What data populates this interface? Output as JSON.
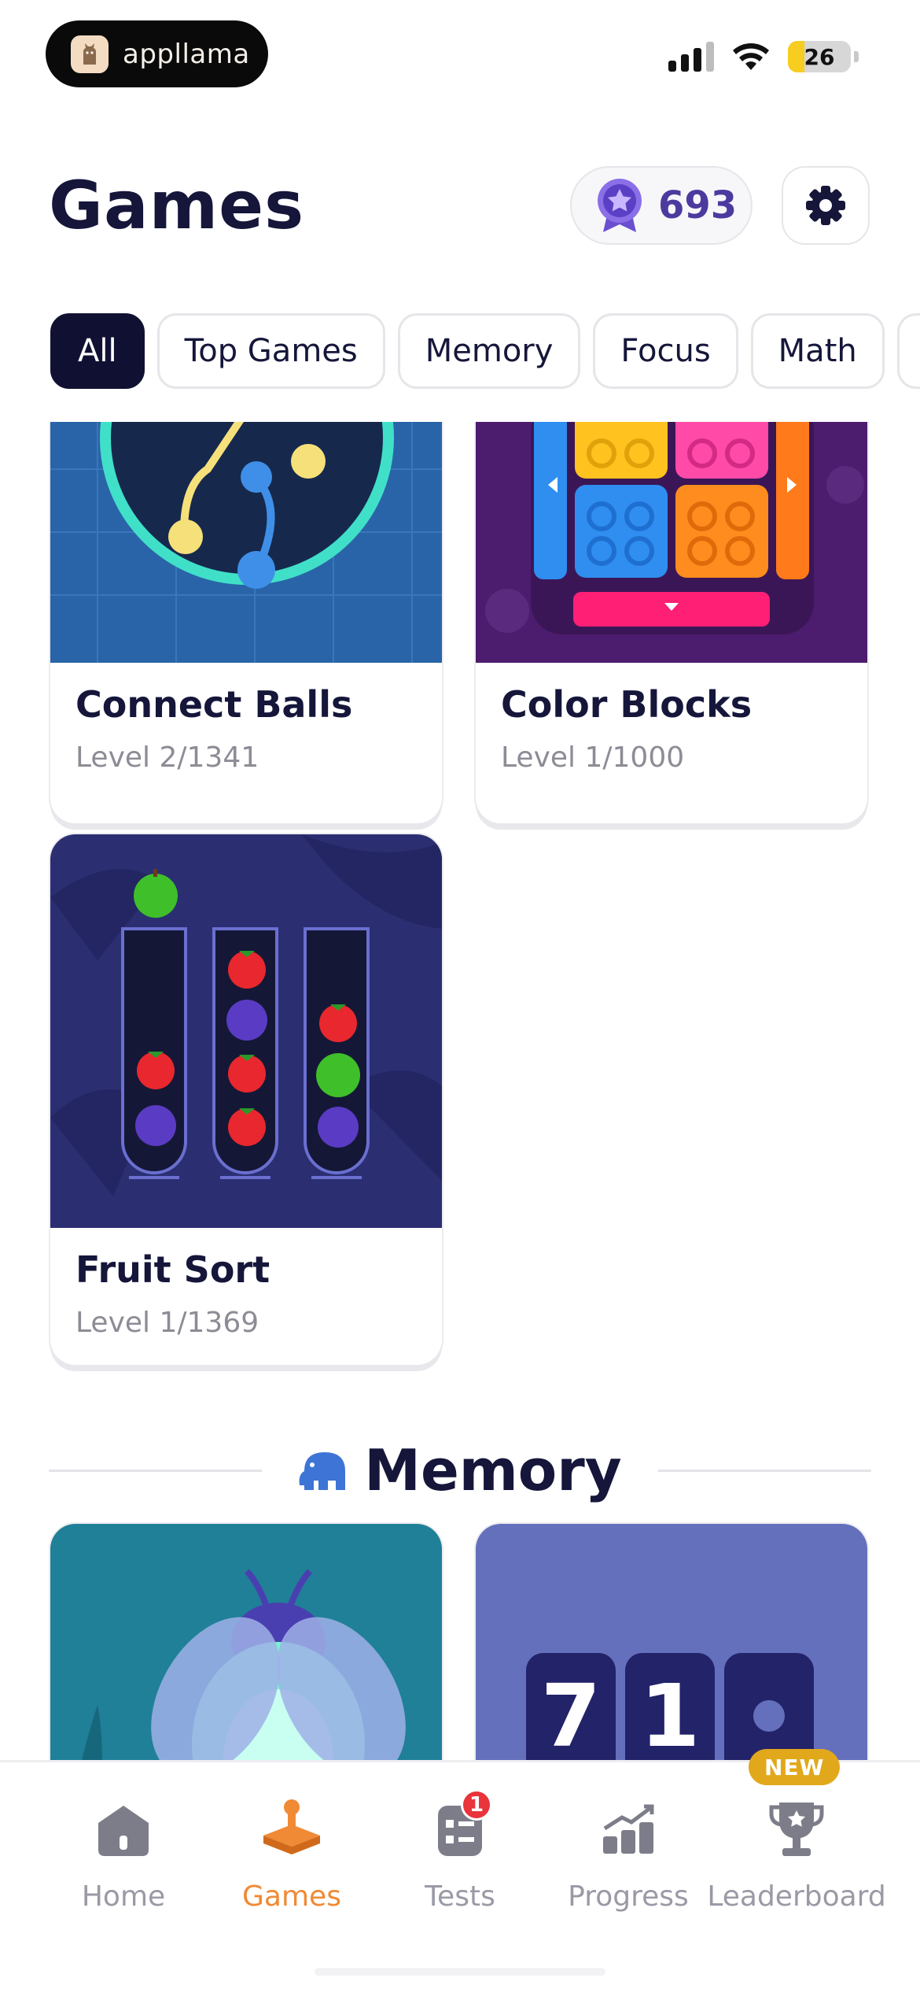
{
  "status_bar": {
    "app_name": "appllama",
    "battery": "26",
    "battery_level": 0.26
  },
  "header": {
    "title": "Games",
    "points": "693",
    "points_icon": "star-medal-icon",
    "settings_icon": "gear-icon"
  },
  "filters": [
    "All",
    "Top Games",
    "Memory",
    "Focus",
    "Math"
  ],
  "active_filter": "All",
  "games": [
    {
      "name": "Connect Balls",
      "level": "Level 2/1341"
    },
    {
      "name": "Color Blocks",
      "level": "Level 1/1000"
    },
    {
      "name": "Fruit Sort",
      "level": "Level 1/1369"
    }
  ],
  "memory_section": {
    "title": "Memory",
    "icon": "elephant-icon",
    "card2_digits": [
      "7",
      "1"
    ]
  },
  "bottom_nav": [
    {
      "label": "Home",
      "icon": "home-icon"
    },
    {
      "label": "Games",
      "icon": "games-icon",
      "active": true
    },
    {
      "label": "Tests",
      "icon": "tests-icon",
      "badge": "1"
    },
    {
      "label": "Progress",
      "icon": "progress-icon"
    },
    {
      "label": "Leaderboard",
      "icon": "trophy-icon",
      "tag": "NEW"
    }
  ],
  "colors": {
    "accent": "#f08a34",
    "dark": "#15163a",
    "points": "#4c3a9e"
  }
}
